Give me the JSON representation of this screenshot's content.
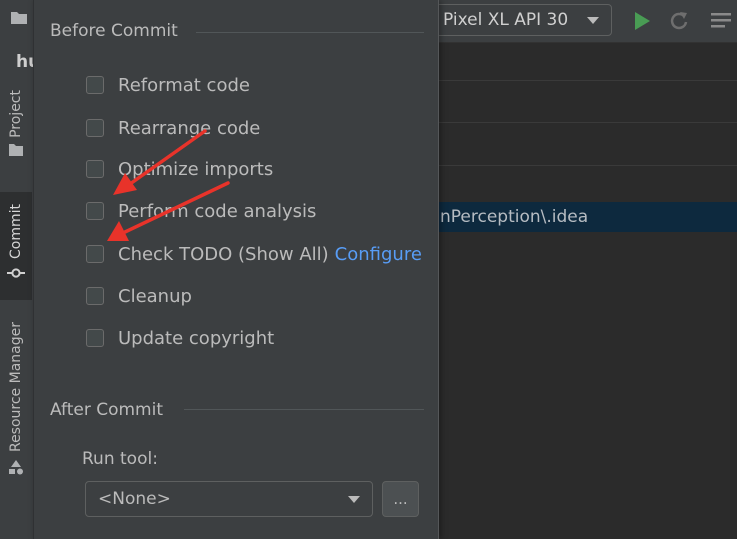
{
  "tool_strip": {
    "tabs": [
      {
        "label": "Project"
      },
      {
        "label": "Commit"
      },
      {
        "label": "Resource Manager"
      }
    ]
  },
  "background": {
    "partial_title": "hu",
    "selected_path": "nPerception\\.idea"
  },
  "toolbar": {
    "device": "Pixel XL API 30",
    "colors": {
      "run": "#499c54",
      "accent": "#589df6"
    }
  },
  "before_commit": {
    "title": "Before Commit",
    "options": [
      {
        "label": "Reformat code",
        "checked": false
      },
      {
        "label": "Rearrange code",
        "checked": false
      },
      {
        "label": "Optimize imports",
        "checked": false
      },
      {
        "label": "Perform code analysis",
        "checked": false
      },
      {
        "label": "Check TODO (Show All)",
        "link": "Configure",
        "checked": false
      },
      {
        "label": "Cleanup",
        "checked": false
      },
      {
        "label": "Update copyright",
        "checked": false
      }
    ]
  },
  "after_commit": {
    "title": "After Commit",
    "run_tool_label": "Run tool:",
    "run_tool_value": "<None>",
    "browse_label": "..."
  },
  "annotations": {
    "arrow_color": "#e8332a"
  }
}
